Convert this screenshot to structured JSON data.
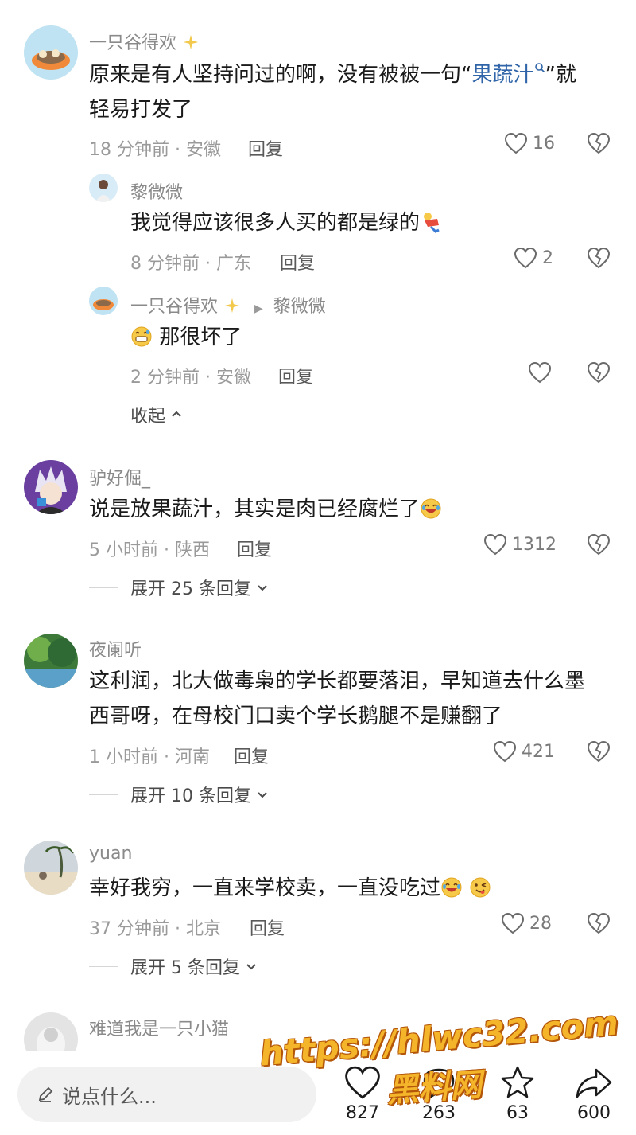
{
  "comments": [
    {
      "user": "一只谷得欢",
      "text_plain": "原来是有人坚持问过的啊，没有被被一句“",
      "link": "果蔬汁",
      "text_after": "”就",
      "text_line2": "轻易打发了",
      "time_loc": "18 分钟前 · 安徽",
      "reply": "回复",
      "likes": "16"
    },
    {
      "user": "黎微微",
      "text": "我觉得应该很多人买的都是绿的",
      "time_loc": "8 分钟前 · 广东",
      "reply": "回复",
      "likes": "2"
    },
    {
      "user": "一只谷得欢",
      "reply_to": "黎微微",
      "text": "那很坏了",
      "time_loc": "2 分钟前 · 安徽",
      "reply": "回复",
      "likes": ""
    },
    {
      "user": "驴好倔_",
      "text": "说是放果蔬汁，其实是肉已经腐烂了",
      "time_loc": "5 小时前 · 陕西",
      "reply": "回复",
      "likes": "1312",
      "expand": "展开 25 条回复"
    },
    {
      "user": "夜阑听",
      "text_line1": "这利润，北大做毒枭的学长都要落泪，早知道去什么墨",
      "text_line2": "西哥呀，在母校门口卖个学长鹅腿不是赚翻了",
      "time_loc": "1 小时前 · 河南",
      "reply": "回复",
      "likes": "421",
      "expand": "展开 10 条回复"
    },
    {
      "user": "yuan",
      "text": "幸好我穷，一直来学校卖，一直没吃过",
      "time_loc": "37 分钟前 · 北京",
      "reply": "回复",
      "likes": "28",
      "expand": "展开 5 条回复"
    },
    {
      "user": "难道我是一只小猫"
    }
  ],
  "collapse": "收起",
  "bottom": {
    "placeholder": "说点什么...",
    "likes": "827",
    "comments": "263",
    "favorites": "63",
    "shares": "600"
  },
  "watermark": {
    "line1": "https://hlwc32.com",
    "line2": "黑料网"
  },
  "colors": {
    "link": "#2f64a8",
    "watermark": "#f5b52a"
  }
}
